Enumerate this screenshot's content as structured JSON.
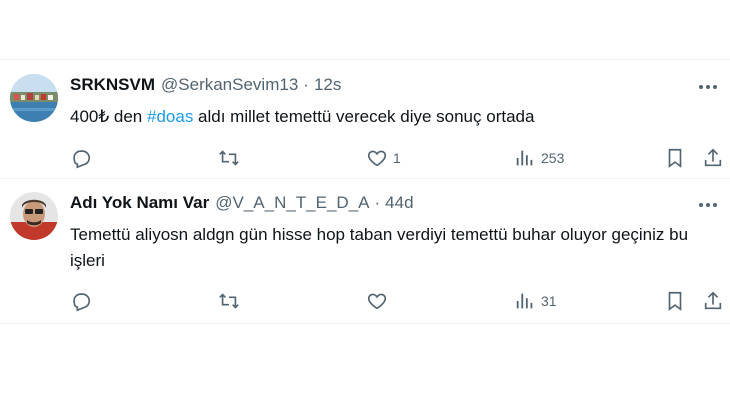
{
  "tweets": [
    {
      "name": "SRKNSVM",
      "handle": "@SerkanSevim13",
      "separator": "·",
      "time": "12s",
      "text_before": "400₺ den ",
      "hashtag": "#doas",
      "text_after": " aldı millet temettü verecek diye sonuç ortada",
      "likes": "1",
      "views": "253"
    },
    {
      "name": "Adı Yok Namı Var",
      "handle": "@V_A_N_T_E_D_A",
      "separator": "·",
      "time": "44d",
      "text": "Temettü aliyosn aldgn gün hisse hop taban verdiyi temettü buhar oluyor geçiniz bu işleri",
      "likes": "",
      "views": "31"
    }
  ],
  "icons": [
    "more-icon",
    "reply-icon",
    "retweet-icon",
    "like-icon",
    "views-icon",
    "bookmark-icon",
    "share-icon"
  ],
  "colors": {
    "text": "#0f1419",
    "secondary": "#536471",
    "link": "#1d9bf0",
    "divider": "#eff3f4"
  }
}
